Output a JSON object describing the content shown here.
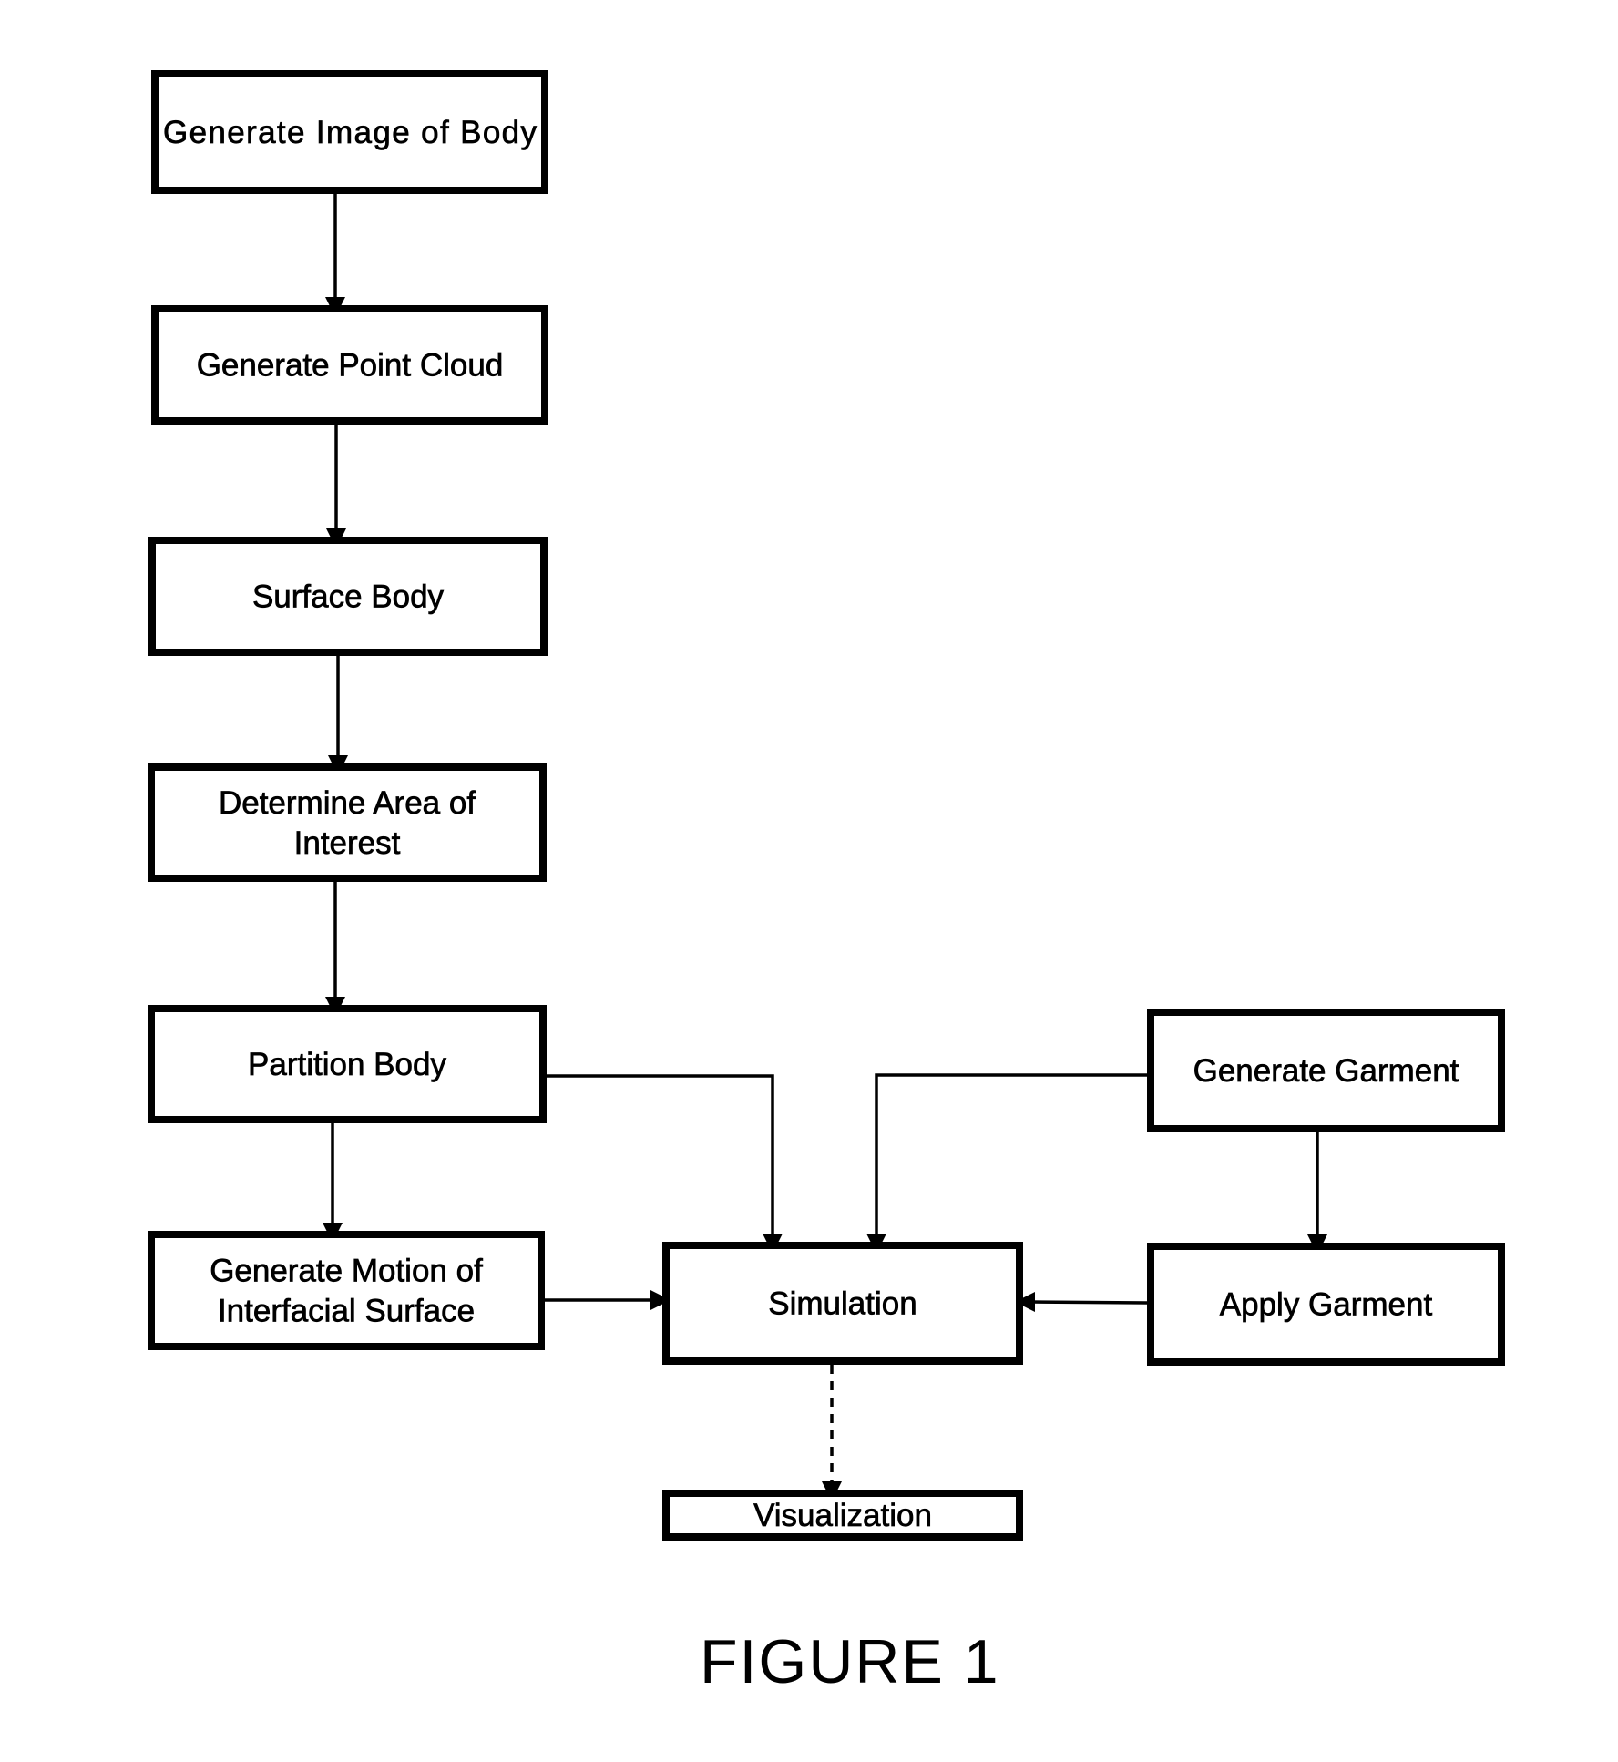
{
  "diagram": {
    "type": "flowchart",
    "caption": "FIGURE 1",
    "nodes": [
      {
        "id": "gen_image",
        "lines": [
          "Generate Image of Body"
        ]
      },
      {
        "id": "point_cloud",
        "lines": [
          "Generate Point Cloud"
        ]
      },
      {
        "id": "surface_body",
        "lines": [
          "Surface Body"
        ]
      },
      {
        "id": "area_interest",
        "lines": [
          "Determine Area of",
          "Interest"
        ]
      },
      {
        "id": "partition",
        "lines": [
          "Partition Body"
        ]
      },
      {
        "id": "motion",
        "lines": [
          "Generate Motion of",
          "Interfacial Surface"
        ]
      },
      {
        "id": "simulation",
        "lines": [
          "Simulation"
        ]
      },
      {
        "id": "gen_garment",
        "lines": [
          "Generate Garment"
        ]
      },
      {
        "id": "apply_garment",
        "lines": [
          "Apply Garment"
        ]
      },
      {
        "id": "visualization",
        "lines": [
          "Visualization"
        ]
      }
    ],
    "edges": [
      {
        "from": "gen_image",
        "to": "point_cloud",
        "style": "solid"
      },
      {
        "from": "point_cloud",
        "to": "surface_body",
        "style": "solid"
      },
      {
        "from": "surface_body",
        "to": "area_interest",
        "style": "solid"
      },
      {
        "from": "area_interest",
        "to": "partition",
        "style": "solid"
      },
      {
        "from": "partition",
        "to": "motion",
        "style": "solid"
      },
      {
        "from": "partition",
        "to": "simulation",
        "style": "solid"
      },
      {
        "from": "motion",
        "to": "simulation",
        "style": "solid"
      },
      {
        "from": "gen_garment",
        "to": "simulation",
        "style": "solid"
      },
      {
        "from": "gen_garment",
        "to": "apply_garment",
        "style": "solid"
      },
      {
        "from": "apply_garment",
        "to": "simulation",
        "style": "solid"
      },
      {
        "from": "simulation",
        "to": "visualization",
        "style": "dashed"
      }
    ]
  }
}
